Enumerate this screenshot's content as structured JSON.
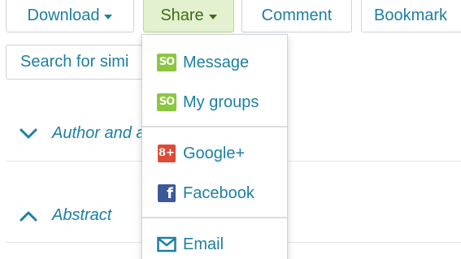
{
  "toolbar": {
    "download_label": "Download",
    "share_label": "Share",
    "comment_label": "Comment",
    "bookmark_label": "Bookmark"
  },
  "search_similar_label": "Search for simi",
  "sections": {
    "author_label": "Author and affiliation",
    "abstract_label": "Abstract"
  },
  "share_menu": {
    "items": [
      {
        "label": "Message",
        "icon": "so-icon"
      },
      {
        "label": "My groups",
        "icon": "so-icon"
      },
      {
        "label": "Google+",
        "icon": "google-plus-icon"
      },
      {
        "label": "Facebook",
        "icon": "facebook-icon"
      },
      {
        "label": "Email",
        "icon": "email-icon"
      }
    ],
    "so_icon_text": "SO",
    "gplus_icon_text": "8+",
    "fb_icon_text": "f"
  },
  "colors": {
    "link_blue": "#1c7fa3",
    "share_active_bg": "#e3f1d0",
    "share_active_text": "#3d6e14",
    "so_green": "#8cc63f",
    "google_red": "#dd4b39",
    "facebook_blue": "#3b5998"
  }
}
